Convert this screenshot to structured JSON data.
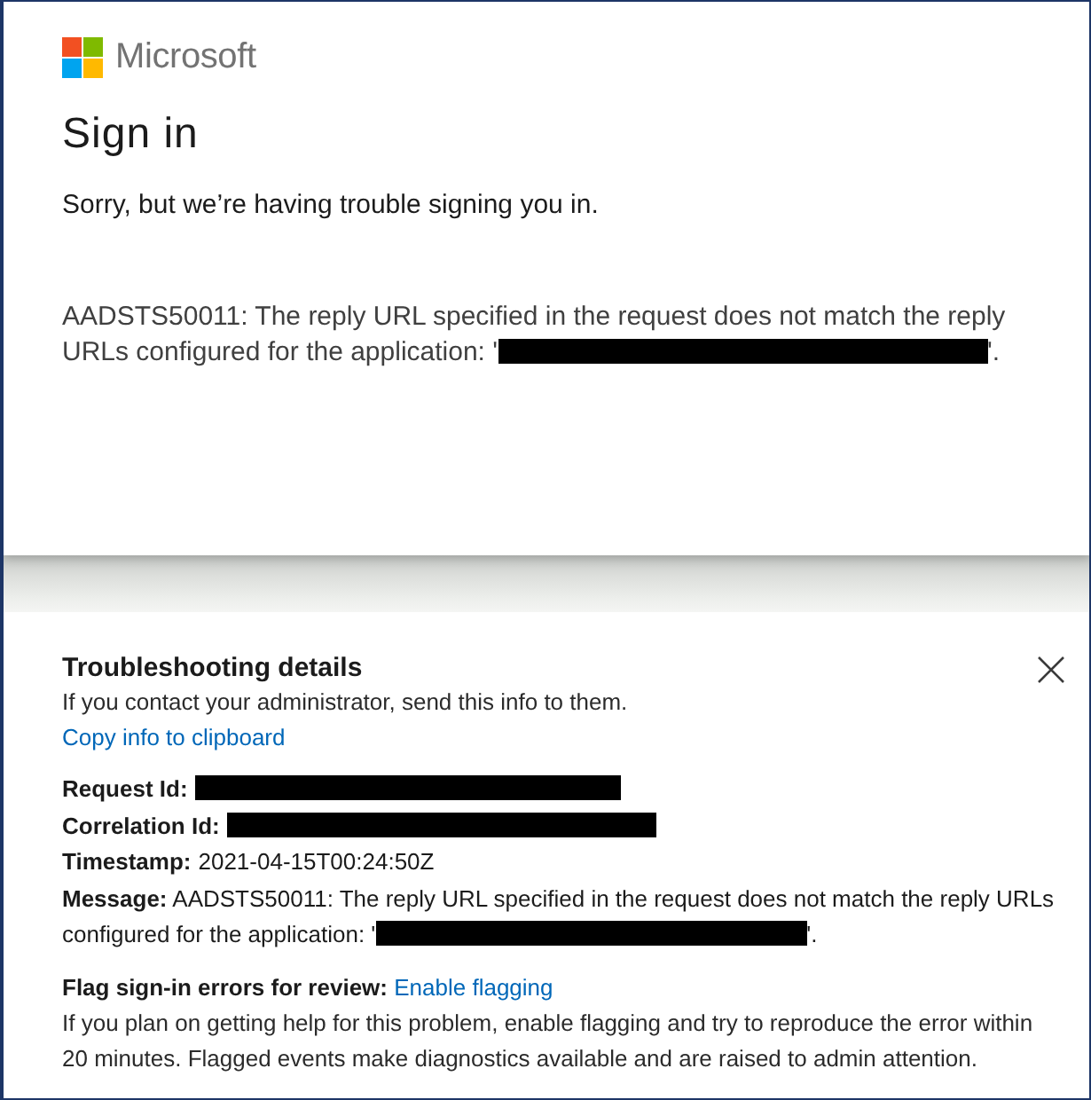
{
  "brand": {
    "name": "Microsoft"
  },
  "heading": "Sign in",
  "intro": "Sorry, but we’re having trouble signing you in.",
  "error": {
    "text": "AADSTS50011: The reply URL specified in the request does not match the reply URLs configured for the application: '",
    "redacted": true,
    "after": "'."
  },
  "troubleshooting": {
    "title": "Troubleshooting details",
    "hint": "If you contact your administrator, send this info to them.",
    "copy_link": "Copy info to clipboard",
    "details": [
      {
        "label": "Request Id:",
        "redacted": true
      },
      {
        "label": "Correlation Id:",
        "redacted": true
      },
      {
        "label": "Timestamp:",
        "value": "2021-04-15T00:24:50Z"
      }
    ],
    "message": {
      "text": "**Message:** AADSTS50011: The reply URL specified in the request does not match the reply URLs configured for the application: '",
      "redacted": true,
      "after": "'."
    },
    "flag": {
      "label": "Flag sign-in errors for review:",
      "link": "Enable flagging",
      "note": "If you plan on getting help for this problem, enable flagging and try to reproduce the error within 20 minutes. Flagged events make diagnostics available and are raised to admin attention."
    }
  }
}
